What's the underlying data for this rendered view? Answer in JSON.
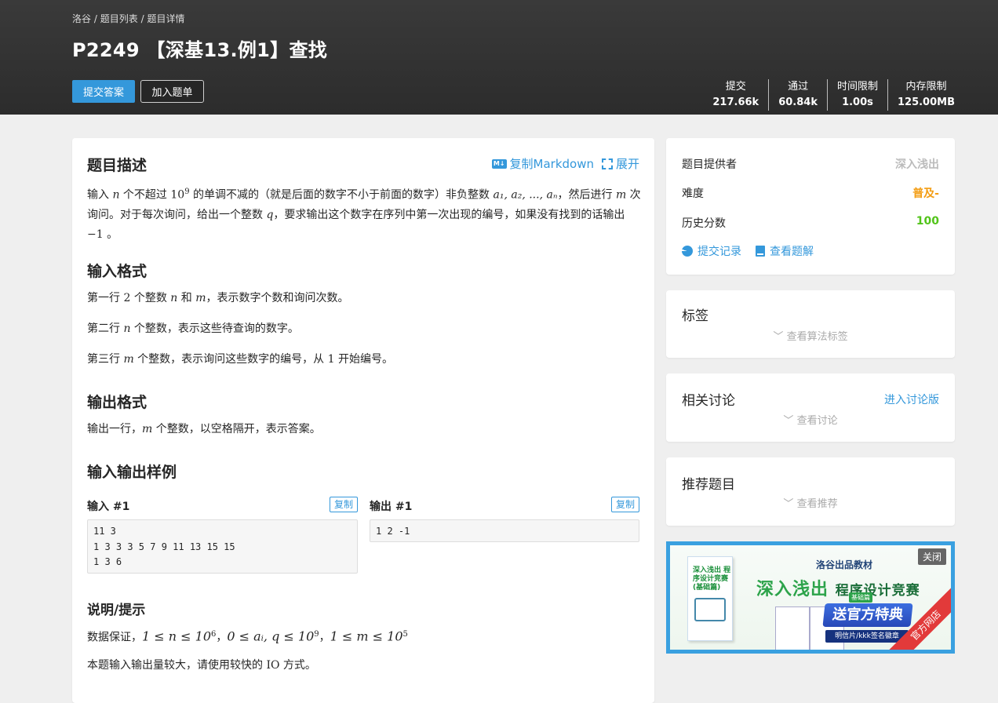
{
  "breadcrumb": {
    "item1": "洛谷",
    "sep": "/",
    "item2": "题目列表",
    "item3": "题目详情"
  },
  "problem": {
    "title": "P2249 【深基13.例1】查找"
  },
  "actions": {
    "submit": "提交答案",
    "add_to_list": "加入题单"
  },
  "stats": [
    {
      "label": "提交",
      "value": "217.66k"
    },
    {
      "label": "通过",
      "value": "60.84k"
    },
    {
      "label": "时间限制",
      "value": "1.00s"
    },
    {
      "label": "内存限制",
      "value": "125.00MB"
    }
  ],
  "toolbar": {
    "copy_markdown": "复制Markdown",
    "md_icon": "M↓",
    "expand": "展开"
  },
  "sections": {
    "description_title": "题目描述",
    "description": [
      "输入 ",
      "n",
      " 个不超过 ",
      "10",
      "9",
      " 的单调不减的（就是后面的数字不小于前面的数字）非负整数 ",
      "a₁, a₂, ..., aₙ",
      "，然后进行 ",
      "m",
      " 次询问。对于每次询问，给出一个整数 ",
      "q",
      "，要求输出这个数字在序列中第一次出现的编号，如果没有找到的话输出 ",
      "−1",
      " 。"
    ],
    "input_title": "输入格式",
    "input_lines": [
      [
        "第一行 ",
        "2",
        " 个整数 ",
        "n",
        " 和 ",
        "m",
        "，表示数字个数和询问次数。"
      ],
      [
        "第二行 ",
        "n",
        " 个整数，表示这些待查询的数字。"
      ],
      [
        "第三行 ",
        "m",
        " 个整数，表示询问这些数字的编号，从 ",
        "1",
        " 开始编号。"
      ]
    ],
    "output_title": "输出格式",
    "output_line": [
      "输出一行，",
      "m",
      " 个整数，以空格隔开，表示答案。"
    ],
    "samples_title": "输入输出样例",
    "hint_title": "说明/提示",
    "hint_line": [
      "数据保证，",
      "1 ≤ n ≤ 10",
      "6",
      "，",
      "0 ≤ aᵢ, q ≤ 10",
      "9",
      "，",
      "1 ≤ m ≤ 10",
      "5"
    ],
    "hint_io": [
      "本题输入输出量较大，请使用较快的 ",
      "IO",
      " 方式。"
    ]
  },
  "samples": {
    "input_label": "输入 #1",
    "output_label": "输出 #1",
    "copy": "复制",
    "input": "11 3\n1 3 3 3 5 7 9 11 13 15 15\n1 3 6",
    "output": "1 2 -1"
  },
  "info": {
    "provider_label": "题目提供者",
    "provider": "深入浅出",
    "difficulty_label": "难度",
    "difficulty": "普及-",
    "history_label": "历史分数",
    "history": "100",
    "records": "提交记录",
    "solutions": "查看题解",
    "difficulty_color": "#f39c11",
    "history_color": "#52c41a"
  },
  "tags": {
    "title": "标签",
    "expand": "查看算法标签"
  },
  "discuss": {
    "title": "相关讨论",
    "link": "进入讨论版",
    "expand": "查看讨论"
  },
  "recommend": {
    "title": "推荐题目",
    "expand": "查看推荐"
  },
  "ad": {
    "publisher": "洛谷出品教材",
    "headline": "深入浅出",
    "headline_sub": "程序设计竞赛",
    "edition": "基础篇",
    "gift": "送官方特典",
    "gift_sub": "明信片/kkk签名徽章",
    "close": "关闭",
    "ribbon": "官方网店",
    "book_title": "深入浅出 程序设计竞赛 (基础篇)"
  },
  "colors": {
    "accent": "#3498db",
    "header_bg": "#2c2c2c"
  }
}
